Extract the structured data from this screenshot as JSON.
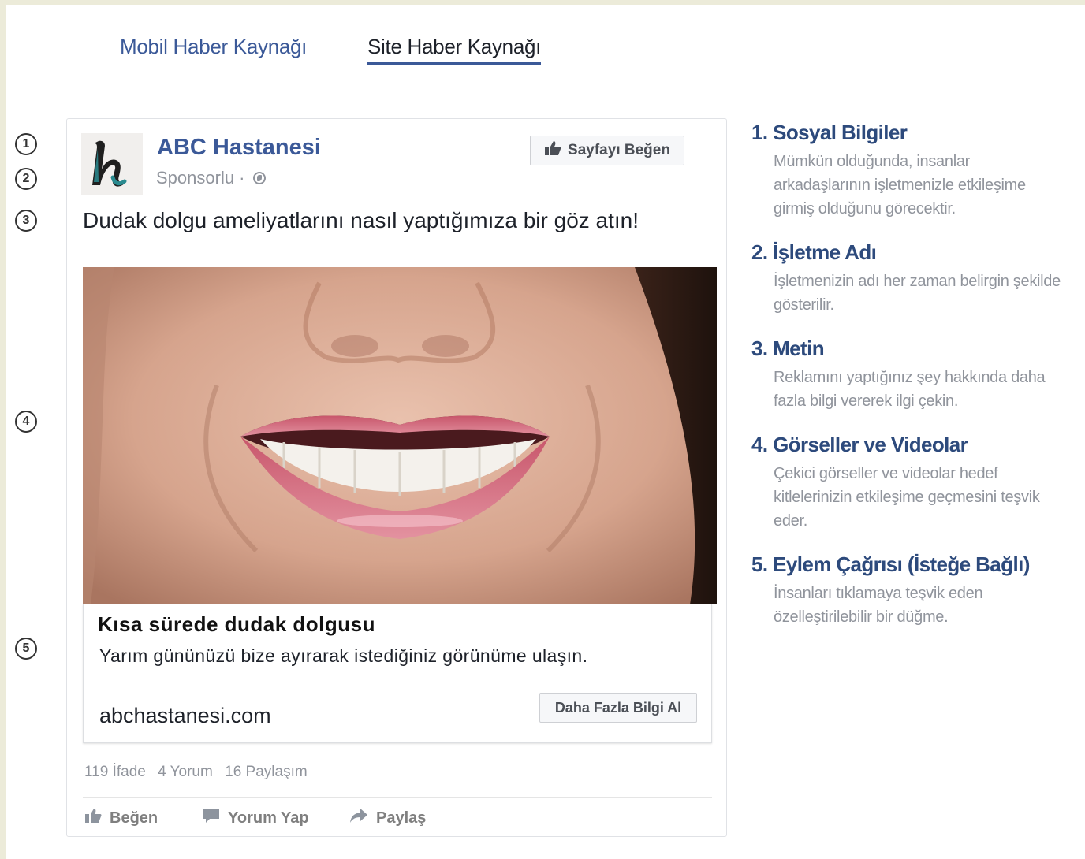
{
  "tabs": {
    "mobile": "Mobil Haber Kaynağı",
    "site": "Site Haber Kaynağı"
  },
  "markers": [
    "1",
    "2",
    "3",
    "4",
    "5"
  ],
  "post": {
    "page_name": "ABC Hastanesi",
    "sponsored": "Sponsorlu ·",
    "like_page_button": "Sayfayı Beğen",
    "text": "Dudak dolgu ameliyatlarını nasıl yaptığımıza bir göz atın!",
    "link": {
      "headline": "Kısa sürede dudak dolgusu",
      "description": "Yarım gününüzü bize ayırarak istediğiniz görünüme ulaşın.",
      "domain": "abchastanesi.com",
      "cta": "Daha Fazla Bilgi Al"
    },
    "stats": {
      "reactions": "119 İfade",
      "comments": "4 Yorum",
      "shares": "16 Paylaşım"
    },
    "actions": {
      "like": "Beğen",
      "comment": "Yorum Yap",
      "share": "Paylaş"
    }
  },
  "notes": [
    {
      "title": "1. Sosyal Bilgiler",
      "body": "Mümkün olduğunda, insanlar arkadaşlarının işletmenizle etkileşime girmiş olduğunu görecektir."
    },
    {
      "title": "2. İşletme Adı",
      "body": "İşletmenizin adı her zaman belirgin şekilde gösterilir."
    },
    {
      "title": "3. Metin",
      "body": "Reklamını yaptığınız şey hakkında daha fazla bilgi vererek ilgi çekin."
    },
    {
      "title": "4. Görseller ve Videolar",
      "body": "Çekici görseller ve videolar hedef kitlelerinizin etkileşime geçmesini teşvik eder."
    },
    {
      "title": "5. Eylem Çağrısı (İsteğe Bağlı)",
      "body": "İnsanları tıklamaya teşvik eden özelleştirilebilir bir düğme."
    }
  ],
  "colors": {
    "facebook_blue": "#3b5998",
    "note_title": "#2d4a7c",
    "meta_gray": "#90949c",
    "logo_teal": "#2a8a8f"
  }
}
